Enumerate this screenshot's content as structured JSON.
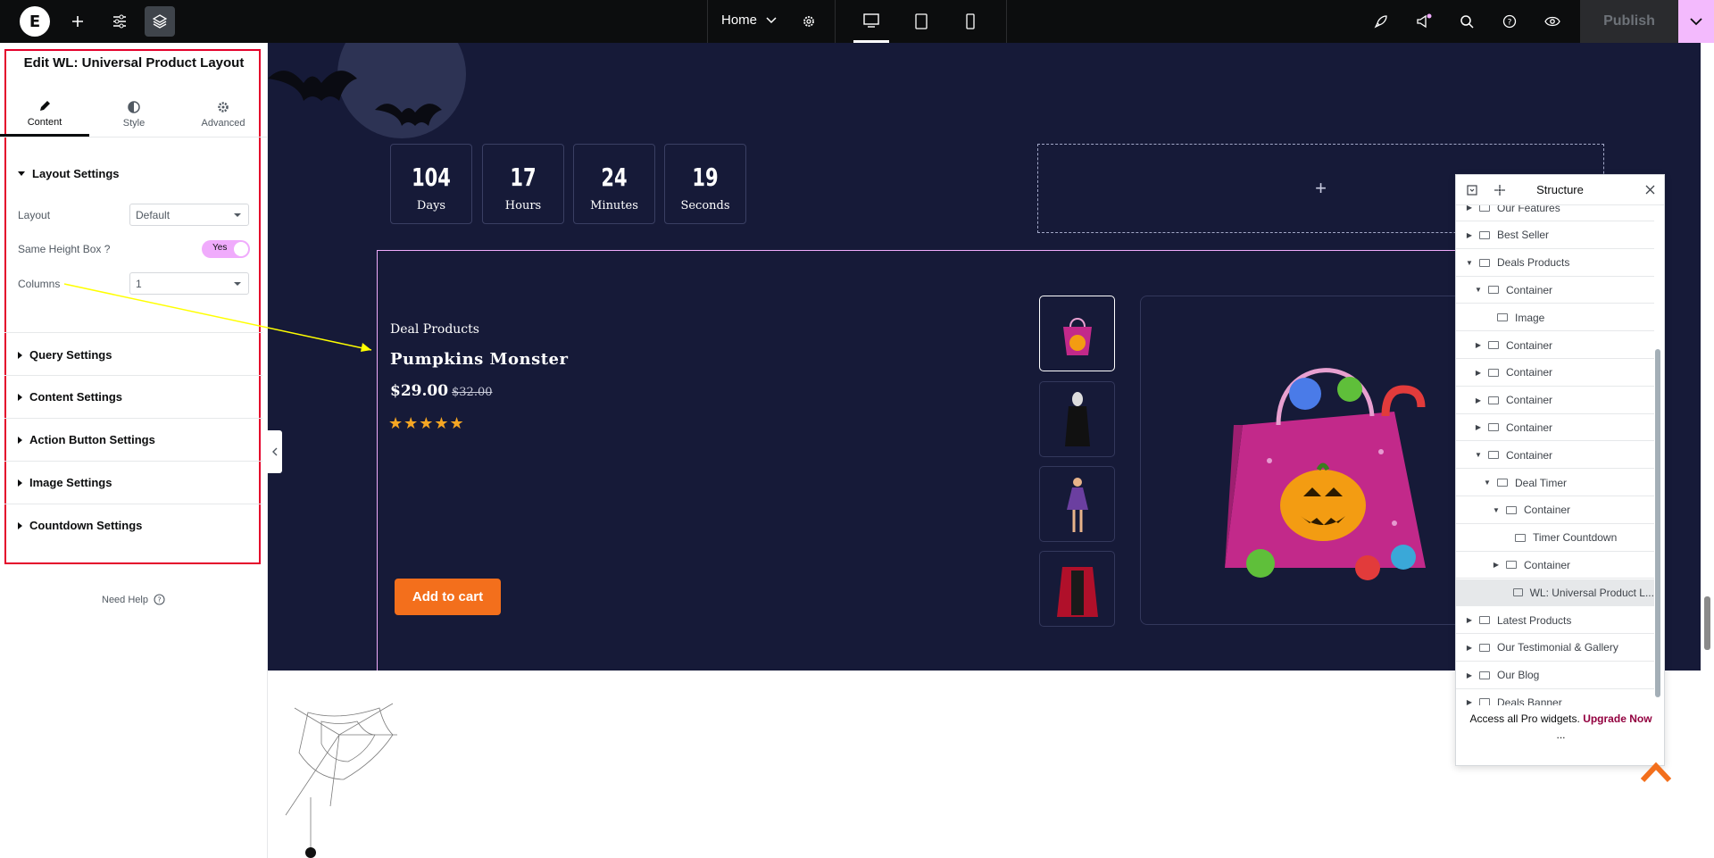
{
  "topbar": {
    "logo": "E",
    "page_name": "Home",
    "publish_label": "Publish"
  },
  "panel": {
    "title": "Edit WL: Universal Product Layout",
    "tabs": [
      {
        "label": "Content",
        "icon": "pencil-icon",
        "active": true
      },
      {
        "label": "Style",
        "icon": "half-circle-icon",
        "active": false
      },
      {
        "label": "Advanced",
        "icon": "gear-icon",
        "active": false
      }
    ],
    "layout_settings": {
      "heading": "Layout Settings",
      "layout_label": "Layout",
      "layout_value": "Default",
      "same_height_label": "Same Height Box ?",
      "same_height_value": "Yes",
      "columns_label": "Columns",
      "columns_value": "1"
    },
    "sections": [
      "Query Settings",
      "Content Settings",
      "Action Button Settings",
      "Image Settings",
      "Countdown Settings"
    ],
    "need_help": "Need Help"
  },
  "canvas": {
    "countdown": [
      {
        "value": "104",
        "label": "Days"
      },
      {
        "value": "17",
        "label": "Hours"
      },
      {
        "value": "24",
        "label": "Minutes"
      },
      {
        "value": "19",
        "label": "Seconds"
      }
    ],
    "add_zone_icon": "+",
    "deal_label": "Deal Products",
    "product_name": "Pumpkins Monster",
    "price": "$29.00",
    "old_price": "$32.00",
    "rating_stars": 5,
    "rating_text": "★★★★★",
    "add_to_cart": "Add to cart",
    "thumbnails": [
      "candy-bag-thumb",
      "ghost-costume-thumb",
      "witch-costume-thumb",
      "vampire-cape-thumb"
    ]
  },
  "structure": {
    "title": "Structure",
    "rows": [
      {
        "label": "Our Features",
        "indent": 0,
        "caret": "right"
      },
      {
        "label": "Best Seller",
        "indent": 0,
        "caret": "right"
      },
      {
        "label": "Deals Products",
        "indent": 0,
        "caret": "down"
      },
      {
        "label": "Container",
        "indent": 1,
        "caret": "down"
      },
      {
        "label": "Image",
        "indent": 2,
        "caret": ""
      },
      {
        "label": "Container",
        "indent": 1,
        "caret": "right"
      },
      {
        "label": "Container",
        "indent": 1,
        "caret": "right"
      },
      {
        "label": "Container",
        "indent": 1,
        "caret": "right"
      },
      {
        "label": "Container",
        "indent": 1,
        "caret": "right"
      },
      {
        "label": "Container",
        "indent": 1,
        "caret": "down"
      },
      {
        "label": "Deal Timer",
        "indent": 2,
        "caret": "down"
      },
      {
        "label": "Container",
        "indent": 3,
        "caret": "down"
      },
      {
        "label": "Timer Countdown",
        "indent": 4,
        "caret": ""
      },
      {
        "label": "Container",
        "indent": 3,
        "caret": "right"
      },
      {
        "label": "WL: Universal Product L...",
        "indent": 4,
        "caret": "",
        "selected": true
      },
      {
        "label": "Latest Products",
        "indent": 0,
        "caret": "right"
      },
      {
        "label": "Our Testimonial & Gallery",
        "indent": 0,
        "caret": "right"
      },
      {
        "label": "Our Blog",
        "indent": 0,
        "caret": "right"
      },
      {
        "label": "Deals Banner",
        "indent": 0,
        "caret": "right"
      }
    ],
    "footer_text": "Access all Pro widgets.",
    "footer_link": "Upgrade Now",
    "footer_more": "..."
  },
  "colors": {
    "accent": "#f0abfc",
    "canvas_dark": "#161a38",
    "cart_button": "#f36f1c",
    "highlight_frame": "#e4002b",
    "arrow": "#ffff00"
  }
}
